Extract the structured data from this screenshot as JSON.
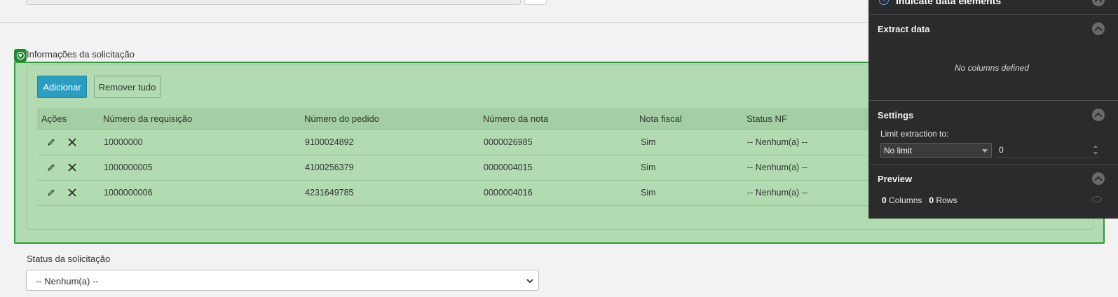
{
  "section": {
    "title": "Informações da solicitação"
  },
  "buttons": {
    "add": "Adicionar",
    "remove_all": "Remover tudo"
  },
  "table": {
    "headers": [
      "Ações",
      "Número da requisição",
      "Número do pedido",
      "Número da nota",
      "Nota fiscal",
      "Status NF"
    ],
    "rows": [
      [
        "10000000",
        "9100024892",
        "0000026985",
        "Sim",
        "-- Nenhum(a) --"
      ],
      [
        "1000000005",
        "4100256379",
        "0000004015",
        "Sim",
        "-- Nenhum(a) --"
      ],
      [
        "1000000006",
        "4231649785",
        "0000004016",
        "Sim",
        "-- Nenhum(a) --"
      ]
    ]
  },
  "status": {
    "label": "Status da solicitação",
    "value": "-- Nenhum(a) --"
  },
  "panel": {
    "header": "Indicate data elements",
    "extract_title": "Extract data",
    "no_columns": "No columns defined",
    "settings_title": "Settings",
    "limit_label": "Limit extraction to:",
    "limit_value": "No limit",
    "limit_number": "0",
    "preview_title": "Preview",
    "columns_count": "0",
    "columns_label": "Columns",
    "rows_count": "0",
    "rows_label": "Rows"
  },
  "colors": {
    "highlight": "#b2dbb2",
    "accent": "#2a9ec0",
    "border_green": "#2d9a3a",
    "panel_bg": "#2b2b2d"
  }
}
